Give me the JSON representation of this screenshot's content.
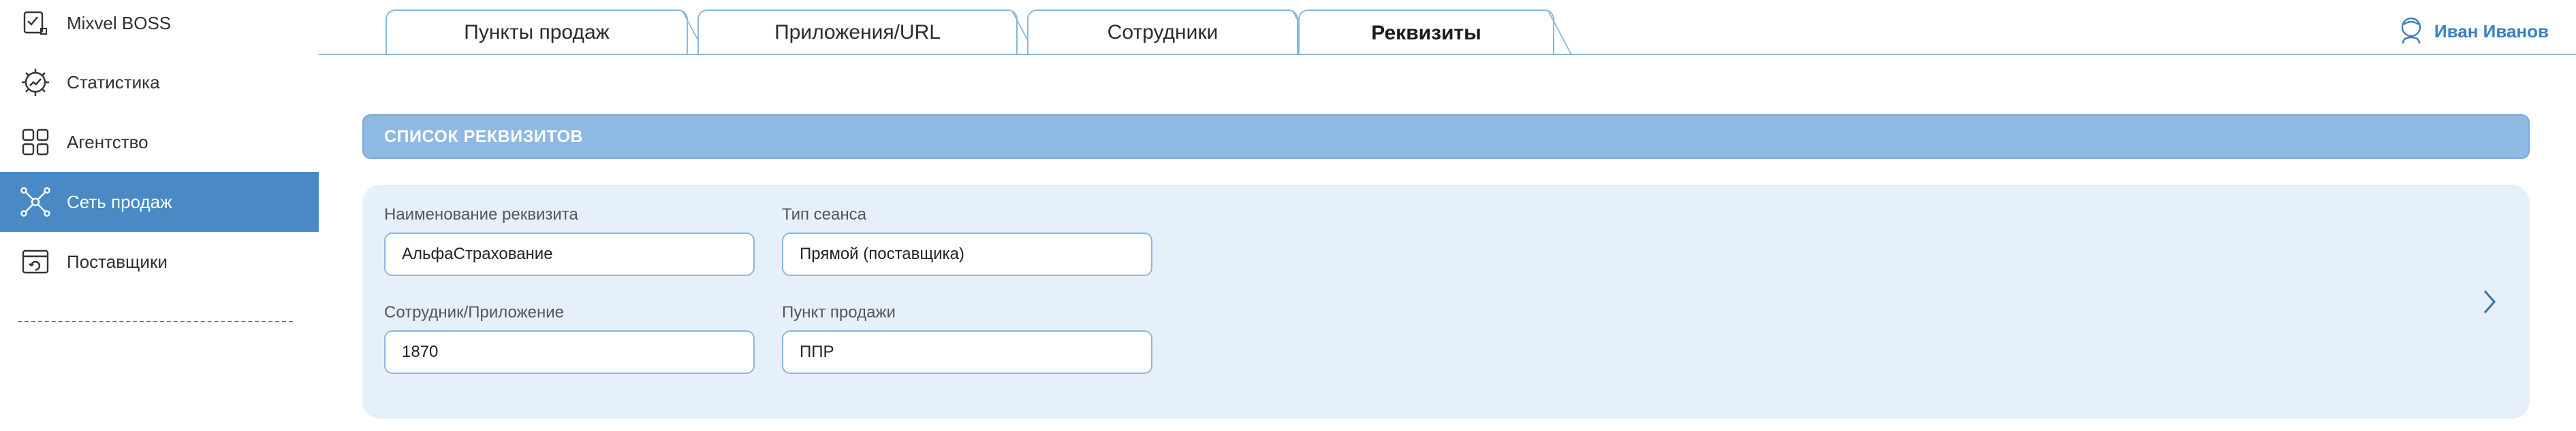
{
  "sidebar": {
    "items": [
      {
        "label": "Mixvel BOSS",
        "icon": "checklist-icon"
      },
      {
        "label": "Статистика",
        "icon": "gear-chart-icon"
      },
      {
        "label": "Агентство",
        "icon": "grid-apps-icon"
      },
      {
        "label": "Сеть продаж",
        "icon": "network-icon",
        "active": true
      },
      {
        "label": "Поставщики",
        "icon": "supplier-icon"
      }
    ]
  },
  "tabs": [
    {
      "label": "Пункты продаж"
    },
    {
      "label": "Приложения/URL"
    },
    {
      "label": "Сотрудники"
    },
    {
      "label": "Реквизиты",
      "active": true
    }
  ],
  "user": {
    "name": "Иван Иванов",
    "icon": "user-icon"
  },
  "section": {
    "title": "СПИСОК РЕКВИЗИТОВ"
  },
  "card": {
    "requisite_name_label": "Наименование реквизита",
    "requisite_name_value": "АльфаСтрахование",
    "session_type_label": "Тип сеанса",
    "session_type_value": "Прямой (поставщика)",
    "employee_app_label": "Сотрудник/Приложение",
    "employee_app_value": "1870",
    "sale_point_label": "Пункт продажи",
    "sale_point_value": "ППР",
    "action_icon": "chevron-right-icon"
  },
  "colors": {
    "accent": "#4a89c6",
    "header_bg": "#8db9e3",
    "card_bg": "#e6f0fb",
    "border": "#8bb7dd",
    "user_text": "#3b7fc0"
  }
}
